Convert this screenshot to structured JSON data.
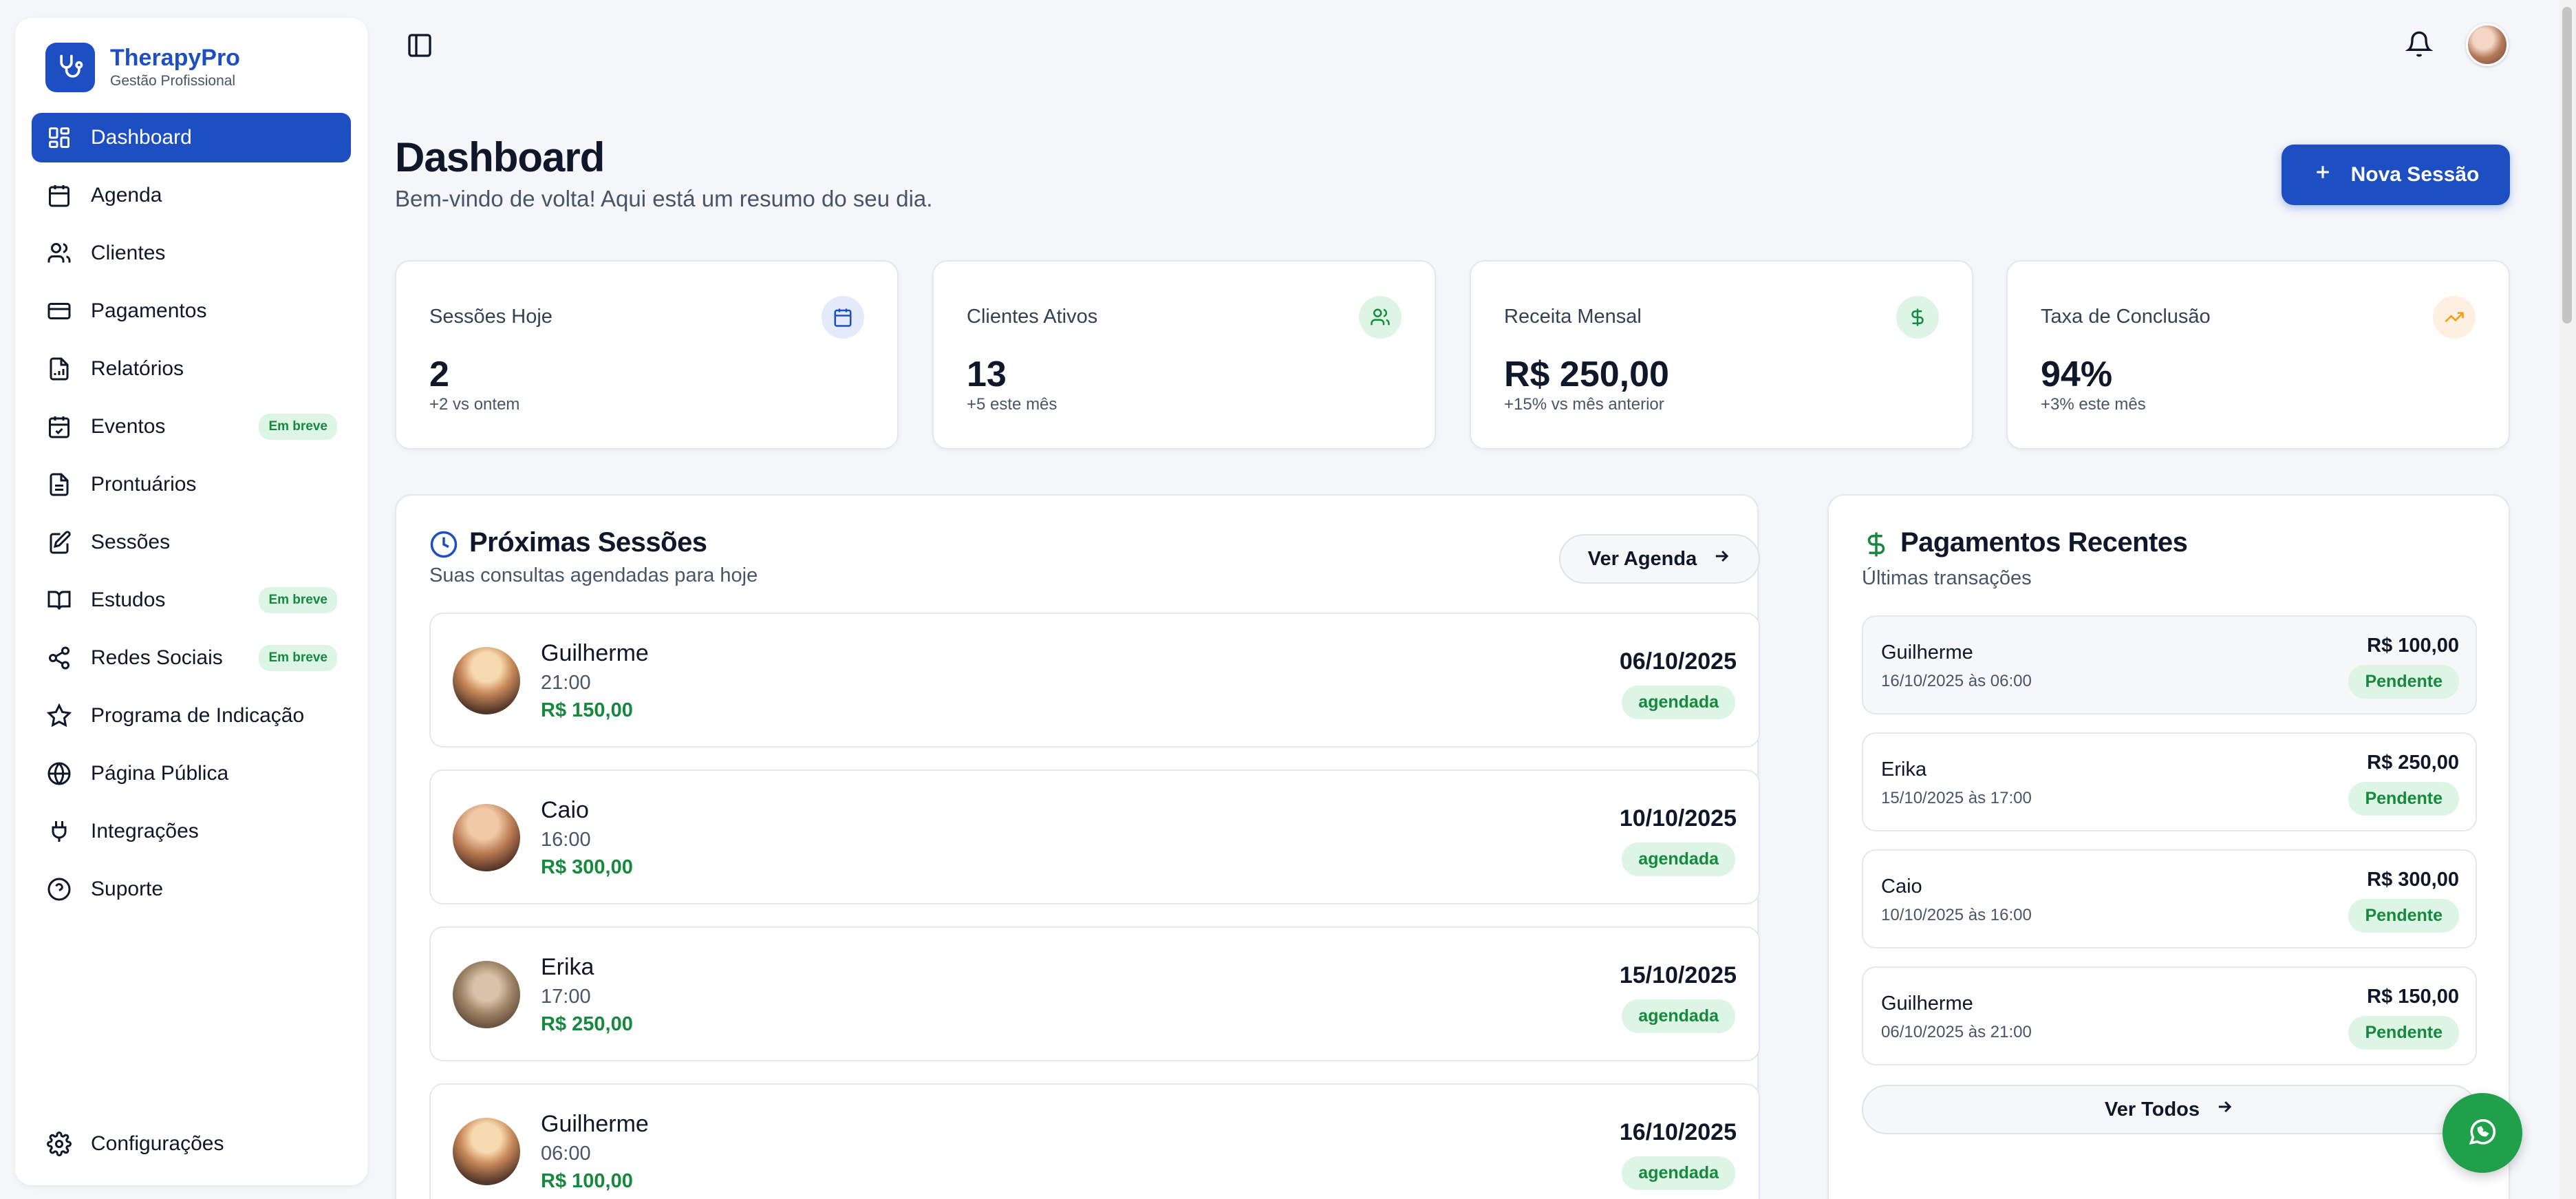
{
  "brand": {
    "name": "TherapyPro",
    "subtitle": "Gestão Profissional"
  },
  "sidebar": {
    "items": [
      {
        "label": "Dashboard",
        "icon": "grid-icon",
        "active": true
      },
      {
        "label": "Agenda",
        "icon": "calendar-icon"
      },
      {
        "label": "Clientes",
        "icon": "users-icon"
      },
      {
        "label": "Pagamentos",
        "icon": "credit-card-icon"
      },
      {
        "label": "Relatórios",
        "icon": "report-icon"
      },
      {
        "label": "Eventos",
        "icon": "calendar-check-icon",
        "badge": "Em breve"
      },
      {
        "label": "Prontuários",
        "icon": "document-icon"
      },
      {
        "label": "Sessões",
        "icon": "edit-note-icon"
      },
      {
        "label": "Estudos",
        "icon": "book-icon",
        "badge": "Em breve"
      },
      {
        "label": "Redes Sociais",
        "icon": "share-icon",
        "badge": "Em breve"
      },
      {
        "label": "Programa de Indicação",
        "icon": "star-icon"
      },
      {
        "label": "Página Pública",
        "icon": "globe-icon"
      },
      {
        "label": "Integrações",
        "icon": "plug-icon"
      },
      {
        "label": "Suporte",
        "icon": "help-icon"
      }
    ],
    "settings_label": "Configurações"
  },
  "header": {
    "title": "Dashboard",
    "subtitle": "Bem-vindo de volta! Aqui está um resumo do seu dia.",
    "new_session_label": "Nova Sessão"
  },
  "stats": [
    {
      "label": "Sessões Hoje",
      "value": "2",
      "sub": "+2 vs ontem",
      "icon": "calendar-icon",
      "color": "#1e4fc2"
    },
    {
      "label": "Clientes Ativos",
      "value": "13",
      "sub": "+5 este mês",
      "icon": "users-icon",
      "color": "#16893e"
    },
    {
      "label": "Receita Mensal",
      "value": "R$ 250,00",
      "sub": "+15% vs mês anterior",
      "icon": "dollar-icon",
      "color": "#16893e"
    },
    {
      "label": "Taxa de Conclusão",
      "value": "94%",
      "sub": "+3% este mês",
      "icon": "trending-up-icon",
      "color": "#f59e0b"
    }
  ],
  "sessions": {
    "title": "Próximas Sessões",
    "subtitle": "Suas consultas agendadas para hoje",
    "button_label": "Ver Agenda",
    "items": [
      {
        "name": "Guilherme",
        "time": "21:00",
        "price": "R$ 150,00",
        "date": "06/10/2025",
        "status": "agendada"
      },
      {
        "name": "Caio",
        "time": "16:00",
        "price": "R$ 300,00",
        "date": "10/10/2025",
        "status": "agendada"
      },
      {
        "name": "Erika",
        "time": "17:00",
        "price": "R$ 250,00",
        "date": "15/10/2025",
        "status": "agendada"
      },
      {
        "name": "Guilherme",
        "time": "06:00",
        "price": "R$ 100,00",
        "date": "16/10/2025",
        "status": "agendada"
      }
    ]
  },
  "payments": {
    "title": "Pagamentos Recentes",
    "subtitle": "Últimas transações",
    "button_label": "Ver Todos",
    "items": [
      {
        "name": "Guilherme",
        "date": "16/10/2025 às 06:00",
        "amount": "R$ 100,00",
        "status": "Pendente"
      },
      {
        "name": "Erika",
        "date": "15/10/2025 às 17:00",
        "amount": "R$ 250,00",
        "status": "Pendente"
      },
      {
        "name": "Caio",
        "date": "10/10/2025 às 16:00",
        "amount": "R$ 300,00",
        "status": "Pendente"
      },
      {
        "name": "Guilherme",
        "date": "06/10/2025 às 21:00",
        "amount": "R$ 150,00",
        "status": "Pendente"
      }
    ]
  },
  "colors": {
    "primary": "#1e4fc2",
    "success": "#16893e",
    "success_bg": "#dcf5e4",
    "whatsapp": "#20a04b"
  }
}
